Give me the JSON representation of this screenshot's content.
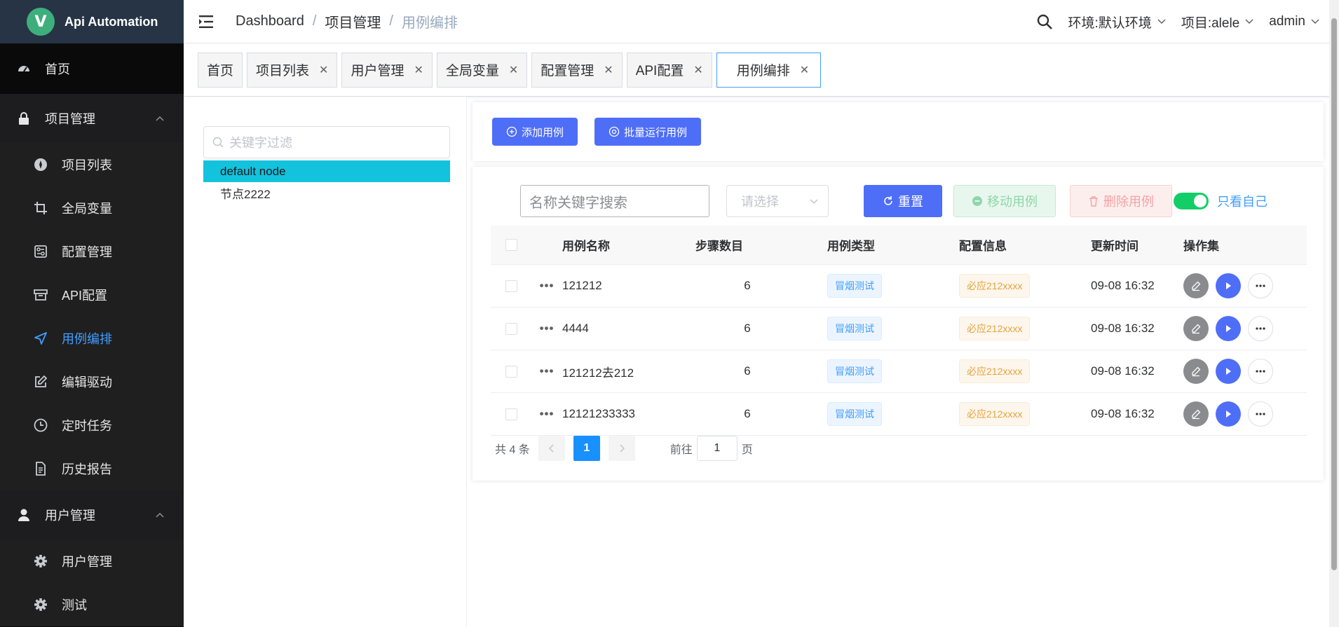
{
  "sidebar": {
    "logo": {
      "mark": "V",
      "text": "Api Automation"
    },
    "home": "首页",
    "project_group": "项目管理",
    "project_items": [
      {
        "label": "项目列表"
      },
      {
        "label": "全局变量"
      },
      {
        "label": "配置管理"
      },
      {
        "label": "API配置"
      },
      {
        "label": "用例编排"
      },
      {
        "label": "编辑驱动"
      },
      {
        "label": "定时任务"
      },
      {
        "label": "历史报告"
      }
    ],
    "user_group": "用户管理",
    "user_items": [
      {
        "label": "用户管理"
      },
      {
        "label": "测试"
      }
    ],
    "active_color": "#409eff"
  },
  "header": {
    "breadcrumb": [
      "Dashboard",
      "项目管理",
      "用例编排"
    ],
    "env": "环境:默认环境",
    "project": "项目:alele",
    "user": "admin"
  },
  "tags": [
    {
      "label": "首页",
      "closable": false
    },
    {
      "label": "项目列表",
      "closable": true
    },
    {
      "label": "用户管理",
      "closable": true
    },
    {
      "label": "全局变量",
      "closable": true
    },
    {
      "label": "配置管理",
      "closable": true
    },
    {
      "label": "API配置",
      "closable": true
    },
    {
      "label": "用例编排",
      "closable": true,
      "active": true
    }
  ],
  "tree": {
    "placeholder": "关键字过滤",
    "nodes": [
      "default node",
      "节点2222"
    ]
  },
  "toolbar": {
    "add_case": "添加用例",
    "batch_run": "批量运行用例"
  },
  "filters": {
    "name_placeholder": "名称关键字搜索",
    "select_placeholder": "请选择",
    "reset": "重置",
    "move": "移动用例",
    "delete": "删除用例",
    "only_mine": "只看自己",
    "only_mine_on": true
  },
  "table": {
    "headers": [
      "用例名称",
      "步骤数目",
      "用例类型",
      "配置信息",
      "更新时间",
      "操作集"
    ],
    "rows": [
      {
        "name": "121212",
        "steps": "6",
        "type": "冒烟测试",
        "config": "必应212xxxx",
        "updated": "09-08 16:32"
      },
      {
        "name": "4444",
        "steps": "6",
        "type": "冒烟测试",
        "config": "必应212xxxx",
        "updated": "09-08 16:32"
      },
      {
        "name": "121212去212",
        "steps": "6",
        "type": "冒烟测试",
        "config": "必应212xxxx",
        "updated": "09-08 16:32"
      },
      {
        "name": "12121233333",
        "steps": "6",
        "type": "冒烟测试",
        "config": "必应212xxxx",
        "updated": "09-08 16:32"
      }
    ]
  },
  "pager": {
    "total": "共 4 条",
    "current": "1",
    "goto_prefix": "前往",
    "goto_value": "1",
    "goto_suffix": "页"
  }
}
